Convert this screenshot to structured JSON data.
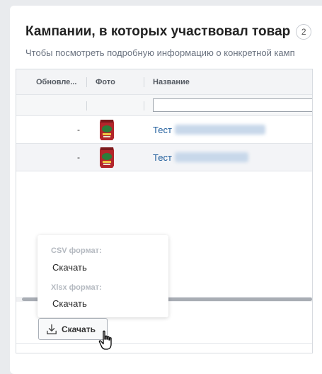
{
  "panel": {
    "title": "Кампании, в которых участвовал товар",
    "count": "2",
    "subtitle": "Чтобы посмотреть подробную информацию о конкретной камп"
  },
  "table": {
    "columns": [
      "Обновле...",
      "Фото",
      "Название"
    ],
    "filter_value": "",
    "rows": [
      {
        "updated": "-",
        "photo": "product-bag-photo",
        "name": "Тест"
      },
      {
        "updated": "-",
        "photo": "product-bag-photo",
        "name": "Тест"
      }
    ]
  },
  "export_menu": {
    "csv_header": "CSV формат:",
    "csv_download": "Скачать",
    "xlsx_header": "Xlsx формат:",
    "xlsx_download": "Скачать"
  },
  "toolbar": {
    "download_label": "Скачать",
    "download_icon": "download-icon"
  },
  "colors": {
    "link": "#1f5d9c",
    "border": "#d7dbe0",
    "header_bg": "#f3f4f6",
    "page_bg": "#e9ebee"
  }
}
